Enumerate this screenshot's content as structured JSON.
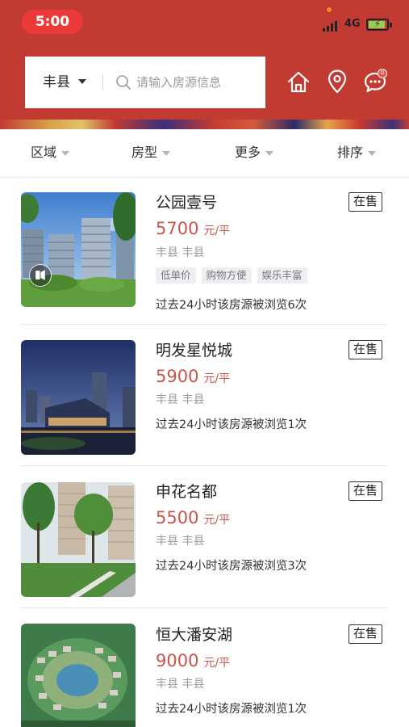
{
  "status_bar": {
    "time": "5:00",
    "network": "4G"
  },
  "header": {
    "city": "丰县",
    "search_placeholder": "请输入房源信息",
    "message_badge": "0"
  },
  "filters": [
    {
      "label": "区域"
    },
    {
      "label": "房型"
    },
    {
      "label": "更多"
    },
    {
      "label": "排序"
    }
  ],
  "listings": [
    {
      "name": "公园壹号",
      "status": "在售",
      "price": "5700",
      "price_unit": "元/平",
      "location": "丰县 丰县",
      "tags": [
        "低单价",
        "购物方便",
        "娱乐丰富"
      ],
      "views_text": "过去24小时该房源被浏览6次",
      "has_video": true
    },
    {
      "name": "明发星悦城",
      "status": "在售",
      "price": "5900",
      "price_unit": "元/平",
      "location": "丰县 丰县",
      "tags": [],
      "views_text": "过去24小时该房源被浏览1次",
      "has_video": false
    },
    {
      "name": "申花名都",
      "status": "在售",
      "price": "5500",
      "price_unit": "元/平",
      "location": "丰县 丰县",
      "tags": [],
      "views_text": "过去24小时该房源被浏览3次",
      "has_video": false
    },
    {
      "name": "恒大潘安湖",
      "status": "在售",
      "price": "9000",
      "price_unit": "元/平",
      "location": "丰县 丰县",
      "tags": [],
      "views_text": "过去24小时该房源被浏览1次",
      "has_video": false
    }
  ],
  "colors": {
    "header_bg": "#c23b33",
    "price": "#c9544b",
    "time_pill": "#ec3a3a"
  },
  "icons": [
    "search-icon",
    "home-icon",
    "location-pin-icon",
    "message-icon",
    "video-icon",
    "chevron-down-icon"
  ]
}
